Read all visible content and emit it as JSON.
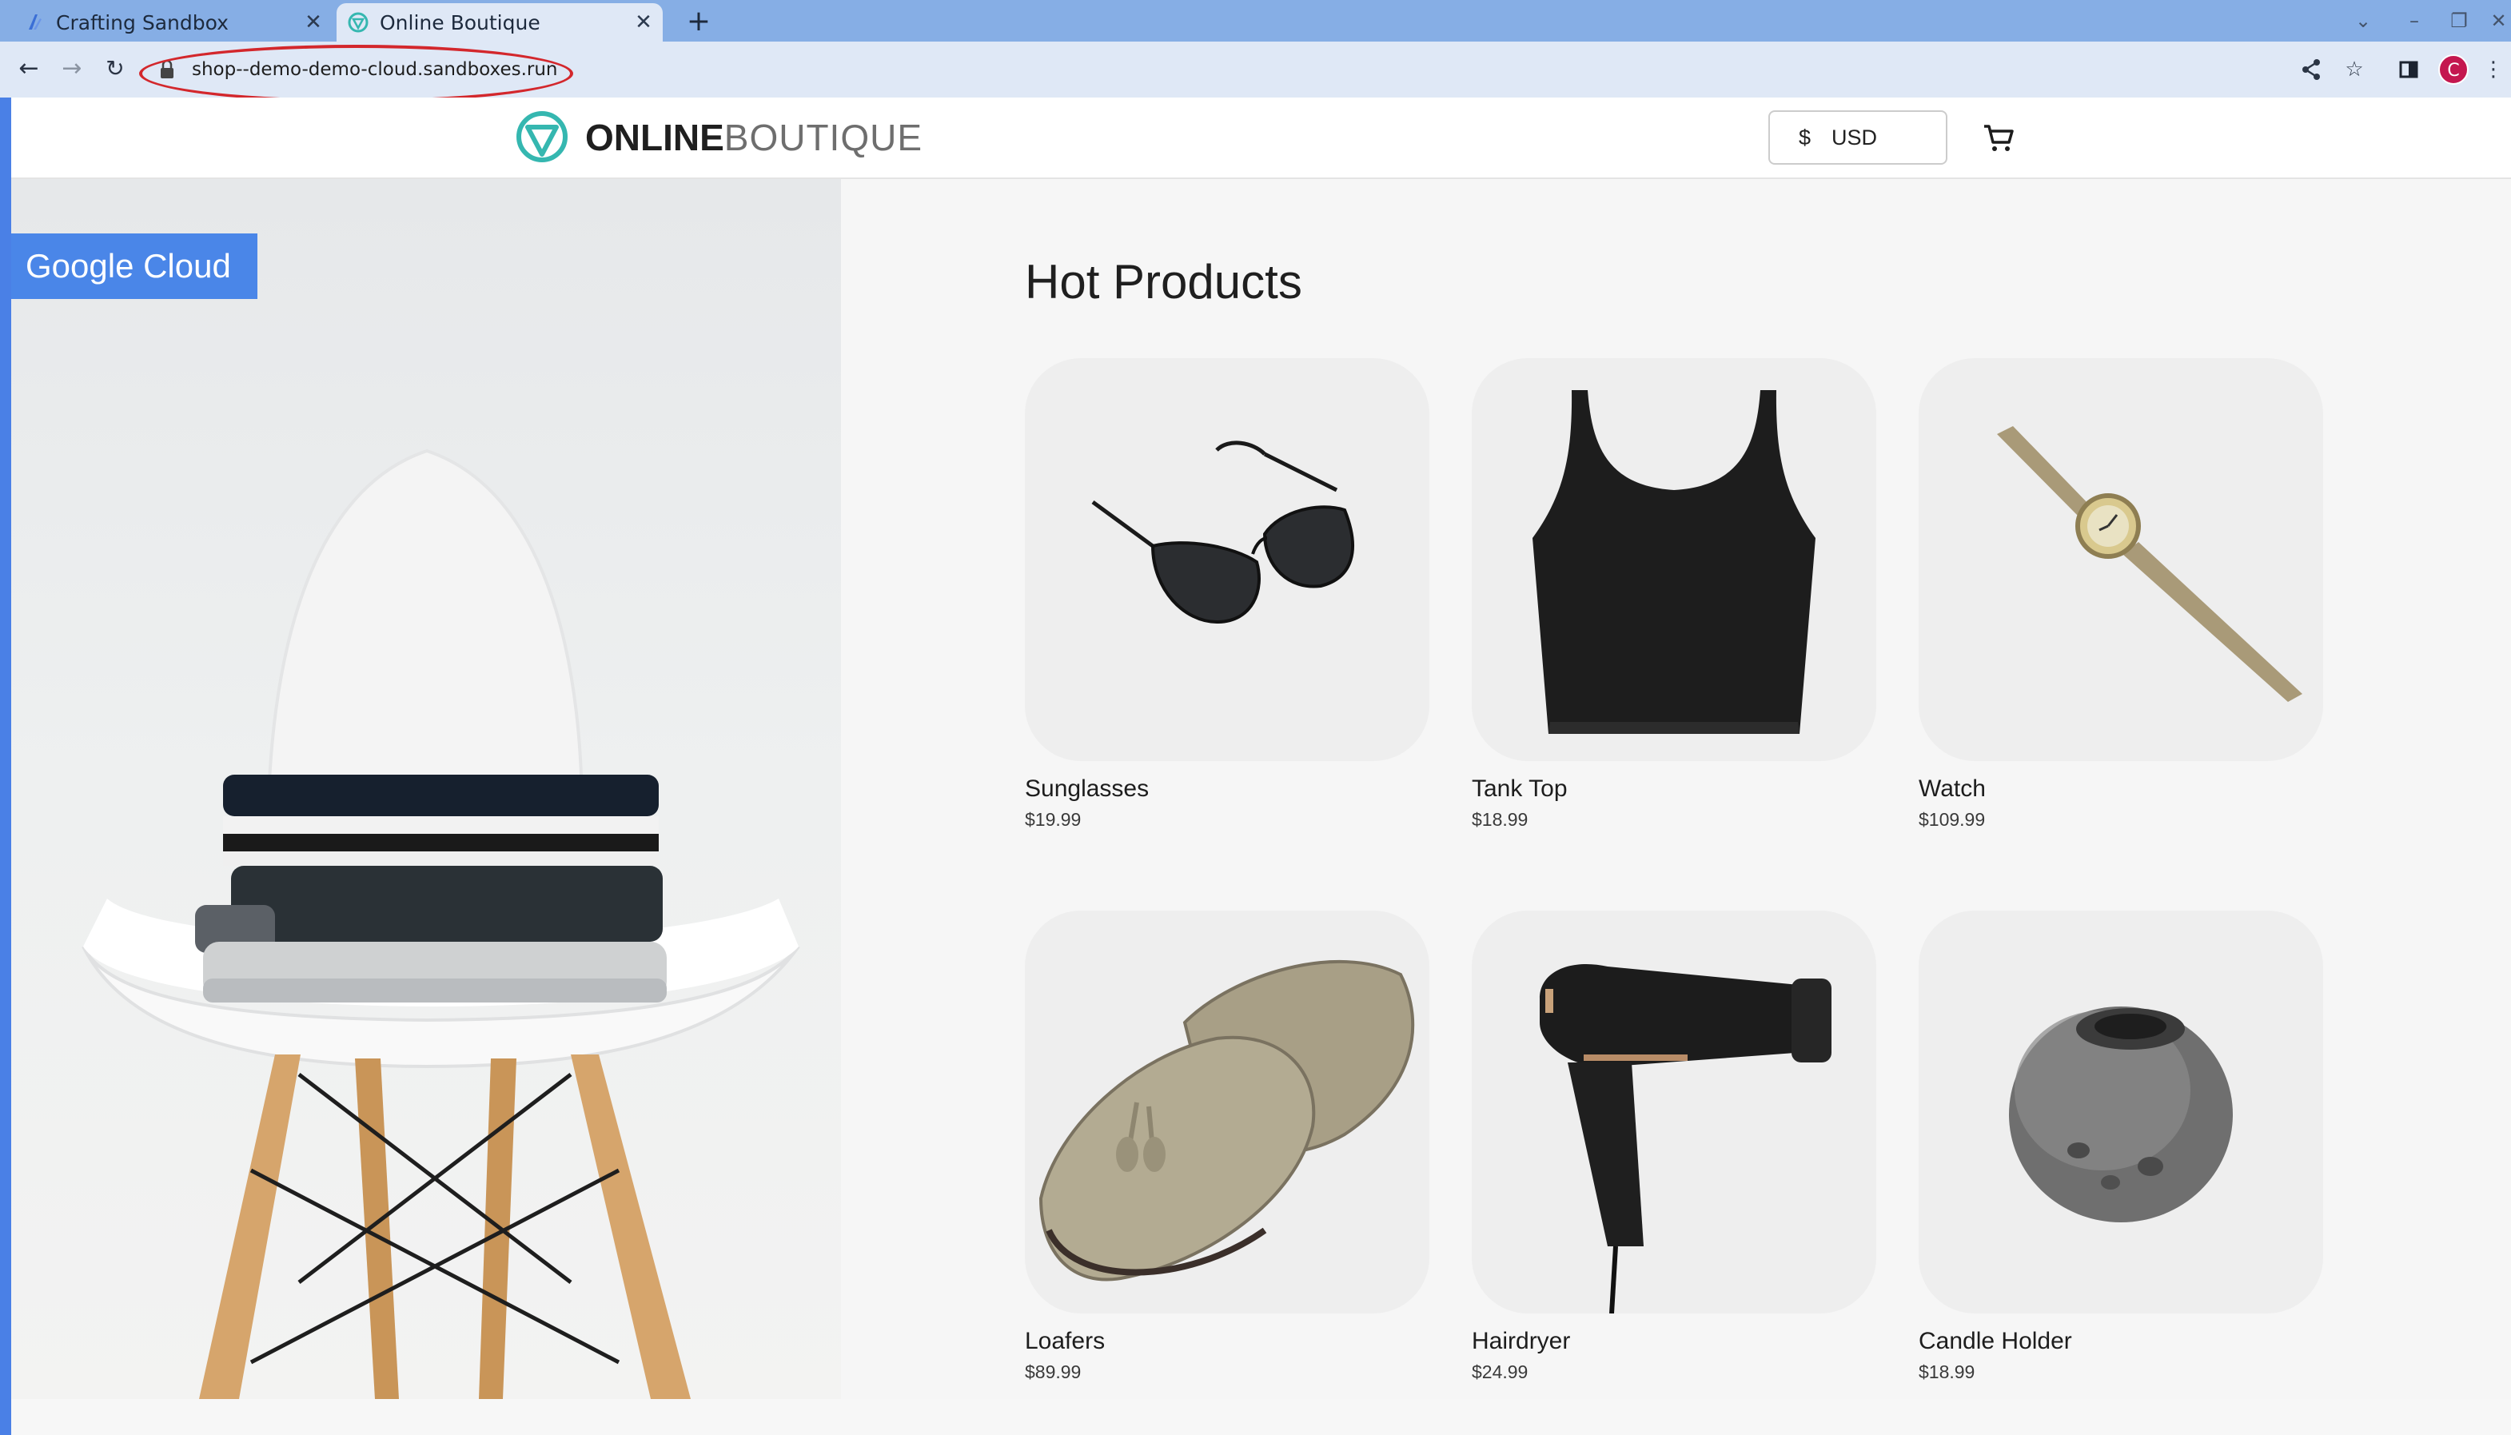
{
  "browser": {
    "tabs": [
      {
        "title": "Crafting Sandbox",
        "active": false
      },
      {
        "title": "Online Boutique",
        "active": true
      }
    ],
    "address": "shop--demo-demo-cloud.sandboxes.run",
    "profile_initial": "C",
    "colors": {
      "tabbar": "#86aee5",
      "toolbar": "#dfe8f6",
      "highlight": "#d3272c",
      "profile": "#c4174f"
    }
  },
  "site": {
    "logo": {
      "bold": "ONLINE",
      "light": "BOUTIQUE",
      "accent": "#35b7b0"
    },
    "currency": {
      "symbol": "$",
      "code": "USD"
    },
    "banner": "Google Cloud",
    "section_title": "Hot Products",
    "products": [
      {
        "name": "Sunglasses",
        "price": "$19.99",
        "icon": "sunglasses"
      },
      {
        "name": "Tank Top",
        "price": "$18.99",
        "icon": "tank-top"
      },
      {
        "name": "Watch",
        "price": "$109.99",
        "icon": "watch"
      },
      {
        "name": "Loafers",
        "price": "$89.99",
        "icon": "loafers"
      },
      {
        "name": "Hairdryer",
        "price": "$24.99",
        "icon": "hairdryer"
      },
      {
        "name": "Candle Holder",
        "price": "$18.99",
        "icon": "candle-holder"
      }
    ]
  }
}
